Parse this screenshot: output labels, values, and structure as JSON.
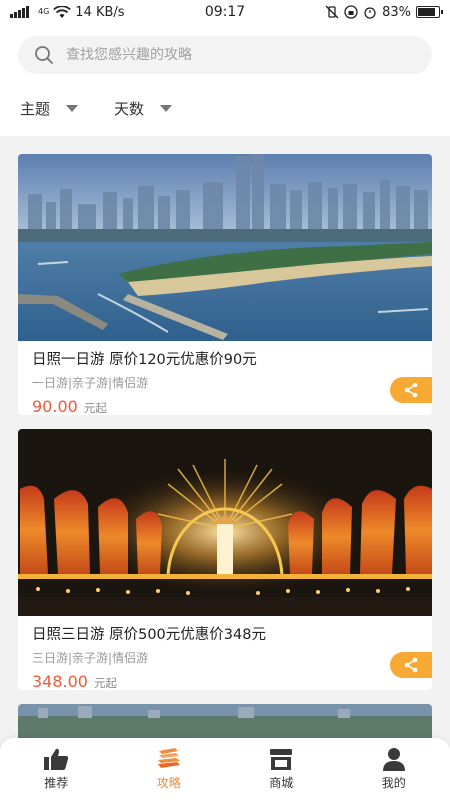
{
  "status_bar": {
    "signal_text": "4G",
    "network_speed": "14 KB/s",
    "time": "09:17",
    "battery_percent": "83%",
    "battery_level": 0.83
  },
  "search": {
    "placeholder": "查找您感兴趣的攻略"
  },
  "filters": [
    {
      "label": "主题"
    },
    {
      "label": "天数"
    }
  ],
  "cards": [
    {
      "title": "日照一日游 原价120元优惠价90元",
      "tags": "一日游|亲子游|情侣游",
      "price": "90.00",
      "price_unit": "元起"
    },
    {
      "title": "日照三日游 原价500元优惠价348元",
      "tags": "三日游|亲子游|情侣游",
      "price": "348.00",
      "price_unit": "元起"
    }
  ],
  "bottom_nav": {
    "items": [
      {
        "label": "推荐",
        "icon": "thumbs-up-icon"
      },
      {
        "label": "攻略",
        "icon": "books-icon",
        "active": true
      },
      {
        "label": "商城",
        "icon": "store-icon"
      },
      {
        "label": "我的",
        "icon": "person-icon"
      }
    ]
  },
  "colors": {
    "accent": "#f08a3c",
    "price": "#ef5a3a",
    "share": "#f8a934"
  }
}
